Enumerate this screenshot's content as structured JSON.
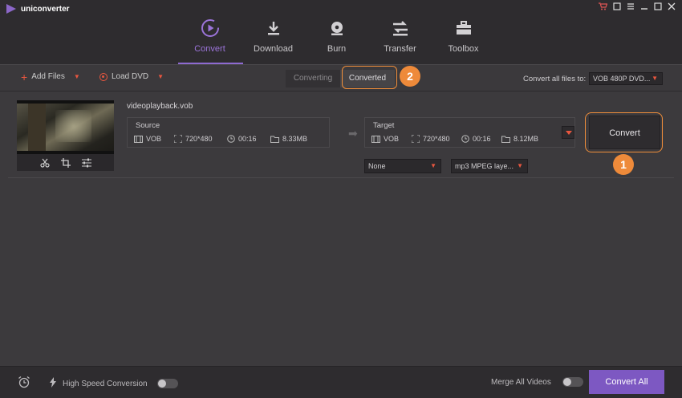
{
  "app": {
    "title": "uniconverter"
  },
  "window_controls": [
    "cart-icon",
    "minimize-small-icon",
    "menu-icon",
    "minimize-icon",
    "maximize-icon",
    "close-icon"
  ],
  "nav": {
    "items": [
      {
        "label": "Convert",
        "icon": "convert-icon",
        "active": true
      },
      {
        "label": "Download",
        "icon": "download-icon",
        "active": false
      },
      {
        "label": "Burn",
        "icon": "burn-icon",
        "active": false
      },
      {
        "label": "Transfer",
        "icon": "transfer-icon",
        "active": false
      },
      {
        "label": "Toolbox",
        "icon": "toolbox-icon",
        "active": false
      }
    ]
  },
  "toolbar": {
    "add_files": "Add Files",
    "load_dvd": "Load DVD",
    "tabs": [
      {
        "label": "Converting"
      },
      {
        "label": "Converted"
      }
    ],
    "convert_all_label": "Convert all files to:",
    "convert_all_value": "VOB 480P DVD..."
  },
  "file": {
    "name": "videoplayback.vob",
    "source": {
      "title": "Source",
      "format": "VOB",
      "resolution": "720*480",
      "duration": "00:16",
      "size": "8.33MB"
    },
    "target": {
      "title": "Target",
      "format": "VOB",
      "resolution": "720*480",
      "duration": "00:16",
      "size": "8.12MB"
    },
    "subtitle_value": "None",
    "audio_value": "mp3 MPEG laye...",
    "convert_label": "Convert"
  },
  "annotations": {
    "badge_1": "1",
    "badge_2": "2"
  },
  "bottom": {
    "high_speed": "High Speed Conversion",
    "merge": "Merge All Videos",
    "convert_all": "Convert All"
  },
  "colors": {
    "accent": "#8e6ad1",
    "highlight": "#f08e3a",
    "red_icon": "#e8563f",
    "convert_all_bg": "#7d58c2"
  }
}
